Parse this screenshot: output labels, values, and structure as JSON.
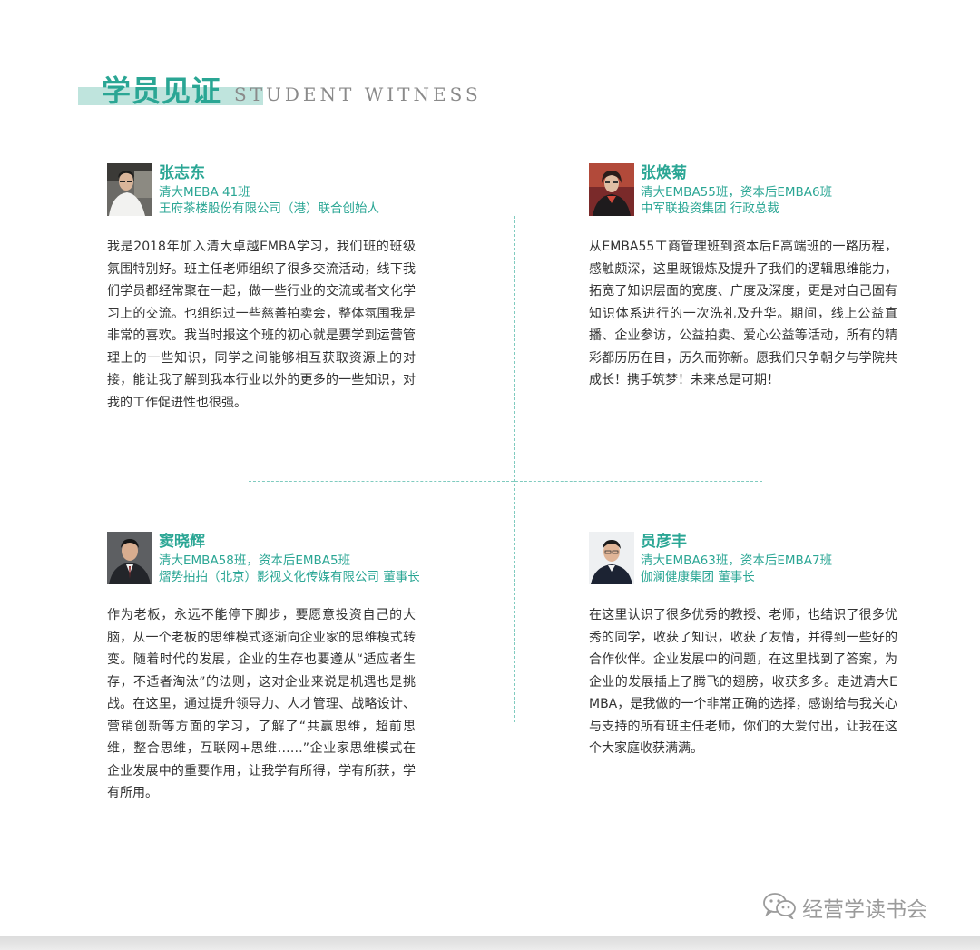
{
  "header": {
    "title_cn": "学员见证",
    "title_en": "STUDENT WITNESS",
    "accent_color": "#2aa694"
  },
  "testimonials": [
    {
      "name": "张志东",
      "line1": "清大MEBA 41班",
      "line2": "王府茶楼股份有限公司（港）联合创始人",
      "text": "我是2018年加入清大卓越EMBA学习，我们班的班级氛围特别好。班主任老师组织了很多交流活动，线下我们学员都经常聚在一起，做一些行业的交流或者文化学习上的交流。也组织过一些慈善拍卖会，整体氛围我是非常的喜欢。我当时报这个班的初心就是要学到运营管理上的一些知识，同学之间能够相互获取资源上的对接，能让我了解到我本行业以外的更多的一些知识，对我的工作促进性也很强。"
    },
    {
      "name": "张焕菊",
      "line1": "清大EMBA55班，资本后EMBA6班",
      "line2": "中军联投资集团 行政总裁",
      "text": "从EMBA55工商管理班到资本后E高端班的一路历程，感触颇深，这里既锻炼及提升了我们的逻辑思维能力，拓宽了知识层面的宽度、广度及深度，更是对自己固有知识体系进行的一次洗礼及升华。期间，线上公益直播、企业参访，公益拍卖、爱心公益等活动，所有的精彩都历历在目，历久而弥新。愿我们只争朝夕与学院共成长！携手筑梦！未来总是可期！"
    },
    {
      "name": "窦晓辉",
      "line1": "清大EMBA58班，资本后EMBA5班",
      "line2": "熠势拍拍（北京）影视文化传媒有限公司 董事长",
      "text": "作为老板，永远不能停下脚步，要愿意投资自己的大脑，从一个老板的思维模式逐渐向企业家的思维模式转变。随着时代的发展，企业的生存也要遵从“适应者生存，不适者淘汰”的法则，这对企业来说是机遇也是挑战。在这里，通过提升领导力、人才管理、战略设计、营销创新等方面的学习，了解了“共赢思维，超前思维，整合思维，互联网+思维……”企业家思维模式在企业发展中的重要作用，让我学有所得，学有所获，学有所用。"
    },
    {
      "name": "员彦丰",
      "line1": "清大EMBA63班，资本后EMBA7班",
      "line2": "伽澜健康集团 董事长",
      "text": "在这里认识了很多优秀的教授、老师，也结识了很多优秀的同学，收获了知识，收获了友情，并得到一些好的合作伙伴。企业发展中的问题，在这里找到了答案，为企业的发展插上了腾飞的翅膀，收获多多。走进清大EMBA，是我做的一个非常正确的选择，感谢给与我关心与支持的所有班主任老师，你们的大爱付出，让我在这个大家庭收获满满。"
    }
  ],
  "watermark": {
    "text": "经营学读书会",
    "icon": "wechat-icon"
  }
}
